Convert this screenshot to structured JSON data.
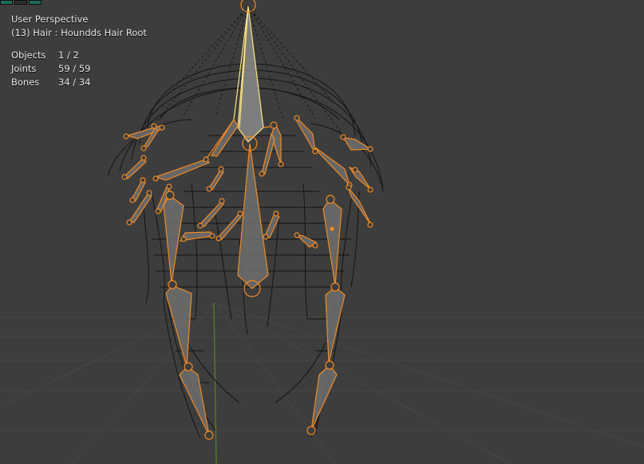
{
  "viewport": {
    "view_name": "User Perspective",
    "active_object": "(13) Hair : Houndds Hair Root",
    "stats": [
      {
        "label": "Objects",
        "value": "1 / 2"
      },
      {
        "label": "Joints",
        "value": "59 / 59"
      },
      {
        "label": "Bones",
        "value": "34 / 34"
      }
    ]
  },
  "colors": {
    "background": "#3d3d3d",
    "grid": "#474747",
    "wire": "#101010",
    "bone_selected": "#f08a24",
    "bone_active": "#ffe680",
    "bone_fill": "#6e6e6e",
    "axis_green": "#4f7a2a"
  },
  "icons": [
    "toolbar-icon",
    "toolbar-icon",
    "toolbar-icon"
  ]
}
